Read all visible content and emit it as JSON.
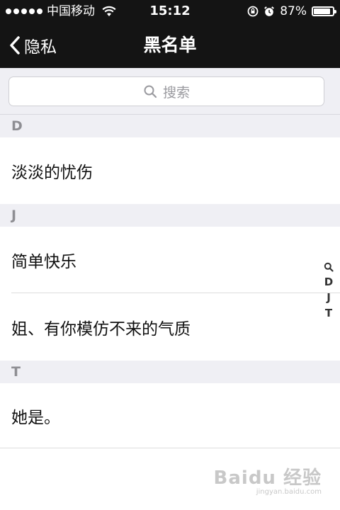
{
  "status_bar": {
    "carrier": "中国移动",
    "time": "15:12",
    "battery_text": "87%",
    "battery_level": 0.87,
    "icons": [
      "signal-dots-icon",
      "wifi-icon",
      "rotation-lock-icon",
      "alarm-icon",
      "battery-icon"
    ]
  },
  "nav": {
    "back_label": "隐私",
    "title": "黑名单"
  },
  "search": {
    "placeholder": "搜索"
  },
  "sections": [
    {
      "header": "D",
      "items": [
        "淡淡的忧伤"
      ]
    },
    {
      "header": "J",
      "items": [
        "简单快乐",
        "姐、有你模仿不来的气质"
      ]
    },
    {
      "header": "T",
      "items": [
        "她是。"
      ]
    }
  ],
  "index_bar": [
    "D",
    "J",
    "T"
  ],
  "watermark": {
    "logo": "Baidu 经验",
    "url": "jingyan.baidu.com"
  }
}
